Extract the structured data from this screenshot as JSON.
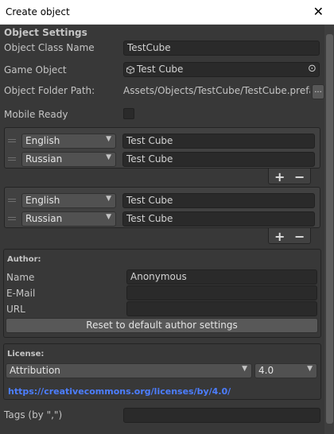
{
  "window": {
    "title": "Create object",
    "close_glyph": "✕"
  },
  "object_settings": {
    "header": "Object Settings",
    "class_name_label": "Object Class Name",
    "class_name_value": "TestCube",
    "game_object_label": "Game Object",
    "game_object_value": "Test Cube",
    "folder_path_label": "Object Folder Path:",
    "folder_path_value": "Assets/Objects/TestCube/TestCube.prefab",
    "browse_label": "...",
    "mobile_ready_label": "Mobile Ready",
    "mobile_ready_checked": false
  },
  "localizations": [
    {
      "rows": [
        {
          "language": "English",
          "text": "Test Cube"
        },
        {
          "language": "Russian",
          "text": "Test Cube"
        }
      ]
    },
    {
      "rows": [
        {
          "language": "English",
          "text": "Test Cube"
        },
        {
          "language": "Russian",
          "text": "Test Cube"
        }
      ]
    }
  ],
  "list_controls": {
    "add": "+",
    "remove": "−"
  },
  "author": {
    "header": "Author:",
    "name_label": "Name",
    "name_value": "Anonymous",
    "email_label": "E-Mail",
    "email_value": "",
    "url_label": "URL",
    "url_value": "",
    "reset_button": "Reset to default author settings"
  },
  "license": {
    "header": "License:",
    "type": "Attribution",
    "version": "4.0",
    "url": "https://creativecommons.org/licenses/by/4.0/"
  },
  "tags": {
    "label": "Tags (by \",\")",
    "value": ""
  },
  "icons": {
    "dropdown": "▼",
    "object_picker": "⊙",
    "cube": "cube-icon"
  },
  "colors": {
    "link": "#4c7eff",
    "background": "#383838"
  }
}
